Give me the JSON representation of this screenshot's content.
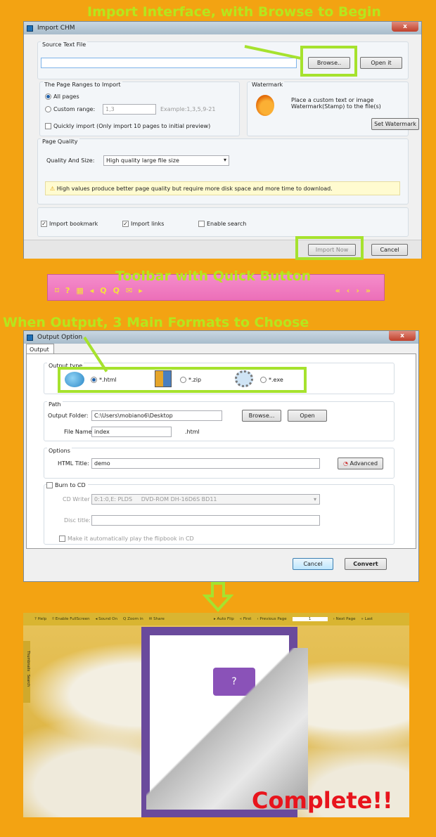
{
  "captions": {
    "import": "Import Interface, with Browse to Begin",
    "toolbar": "Toolbar with Quick Button",
    "output": "When Output, 3 Main Formats to Choose",
    "complete": "Complete!!"
  },
  "import_dialog": {
    "title": "Import CHM",
    "close": "x",
    "source": {
      "label": "Source Text File",
      "value": "",
      "browse": "Browse..",
      "open": "Open it"
    },
    "ranges": {
      "label": "The Page Ranges to Import",
      "all": "All pages",
      "custom": "Custom range:",
      "custom_value": "1,3",
      "example": "Example:1,3,5,9-21",
      "quick": "Quickly import (Only import 10 pages to  initial  preview)",
      "selected": "all"
    },
    "watermark": {
      "label": "Watermark",
      "desc1": "Place a custom text or image",
      "desc2": "Watermark(Stamp) to the file(s)",
      "button": "Set Watermark"
    },
    "quality": {
      "label": "Page Quality",
      "field_label": "Quality And Size:",
      "value": "High quality large file size",
      "warning": "High values produce better page quality but require more disk space and more time to download."
    },
    "options": {
      "bookmark": "Import bookmark",
      "bookmark_checked": true,
      "links": "Import links",
      "links_checked": true,
      "search": "Enable search",
      "search_checked": false
    },
    "import_now": "Import Now",
    "cancel": "Cancel"
  },
  "toolbar": {
    "left_icons": [
      "fullscreen-icon",
      "help-icon",
      "thumbnails-icon",
      "sound-icon",
      "zoom-in-icon",
      "search-icon",
      "email-icon",
      "play-icon"
    ],
    "right_icons": [
      "first-icon",
      "previous-icon",
      "next-icon",
      "last-icon"
    ],
    "colors": {
      "bg": "#f07cc0",
      "icon": "#f5e33a"
    }
  },
  "output_dialog": {
    "title": "Output Option",
    "close": "x",
    "tab": "Output",
    "type": {
      "label": "Output type",
      "options": [
        "*.html",
        "*.zip",
        "*.exe"
      ],
      "selected": "*.html"
    },
    "path": {
      "label": "Path",
      "folder_label": "Output Folder:",
      "folder": "C:\\Users\\mobiano6\\Desktop",
      "browse": "Browse...",
      "open": "Open",
      "file_label": "File Name:",
      "file": "index",
      "ext": ".html"
    },
    "options": {
      "label": "Options",
      "title_label": "HTML Title:",
      "title": "demo",
      "advanced": "Advanced"
    },
    "burn": {
      "label": "Burn to CD",
      "writer_label": "CD Writer",
      "writer": "0:1:0,E: PLDS     DVD-ROM DH-16D6S BD11",
      "disc_label": "Disc title:",
      "disc": "",
      "autoplay": "Make it automatically play the flipbook in CD"
    },
    "cancel": "Cancel",
    "convert": "Convert"
  },
  "flipbook": {
    "toolbar": {
      "help": "Help",
      "fullscreen": "Enable FullScreen",
      "sound": "Sound On",
      "zoom": "Zoom in",
      "share": "Share",
      "autoflip": "Auto Flip",
      "first": "First",
      "prev": "Previous Page",
      "page": "1",
      "next": "Next Page",
      "last": "Last"
    },
    "side": {
      "thumbnails": "Thumbnails",
      "search": "Search"
    }
  }
}
